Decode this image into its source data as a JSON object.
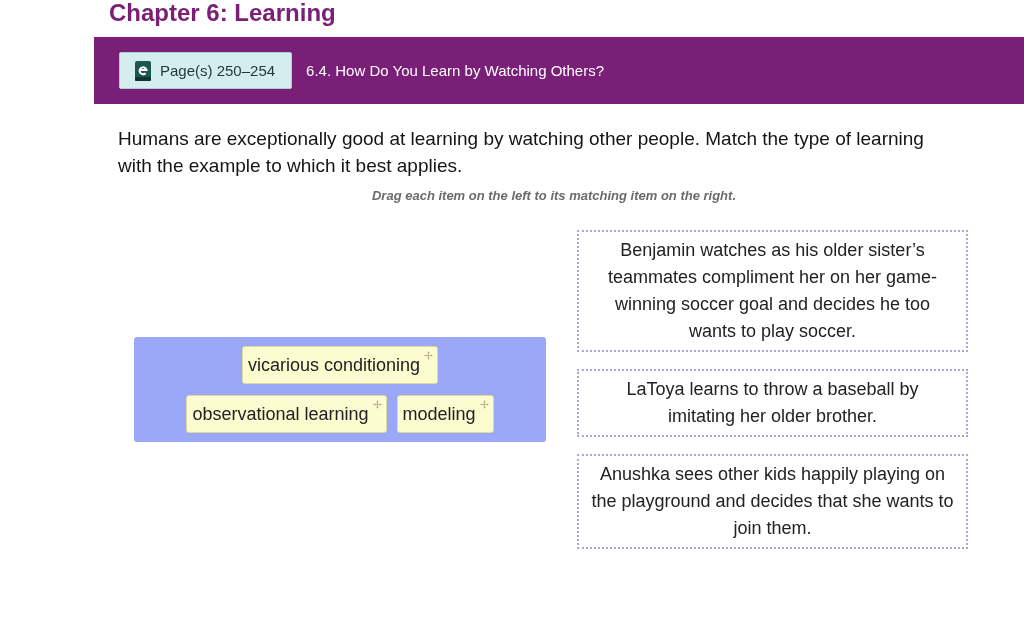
{
  "chapter_title": "Chapter 6: Learning",
  "section_bar": {
    "page_link": "Page(s) 250–254",
    "section_title": "6.4. How Do You Learn by Watching Others?"
  },
  "question": "Humans are exceptionally good at learning by watching other people. Match the type of learning with the example to which it best applies.",
  "instruction": "Drag each item on the left to its matching item on the right.",
  "items": [
    {
      "label": "vicarious conditioning"
    },
    {
      "label": "observational learning"
    },
    {
      "label": "modeling"
    }
  ],
  "targets": [
    {
      "text": "Benjamin watches as his older sister’s teammates compliment her on her game-winning soccer goal and decides he too wants to play soccer."
    },
    {
      "text": "LaToya learns to throw a baseball by imitating her older brother."
    },
    {
      "text": "Anushka sees other kids happily playing on the playground and decides that she wants to join them."
    }
  ]
}
